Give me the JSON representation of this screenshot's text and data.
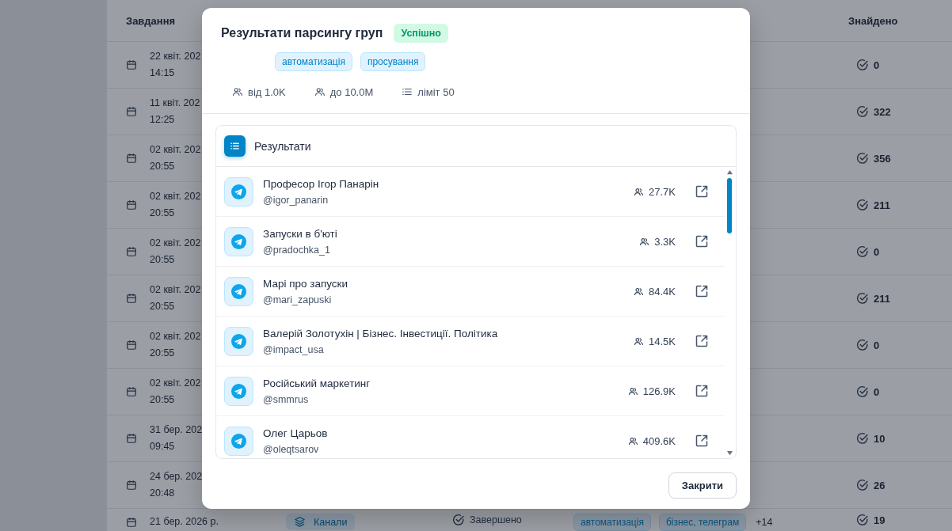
{
  "background_table": {
    "columns": [
      "Завдання",
      "Знайдено"
    ],
    "rows": [
      {
        "date": "22 квіт. 202",
        "time": "14:15",
        "found": "0"
      },
      {
        "date": "11 квіт. 202",
        "time": "12:25",
        "found": "322"
      },
      {
        "date": "02 квіт. 202",
        "time": "20:55",
        "found": "356"
      },
      {
        "date": "02 квіт. 202",
        "time": "20:55",
        "found": "211"
      },
      {
        "date": "02 квіт. 202",
        "time": "20:55",
        "found": "0"
      },
      {
        "date": "02 квіт. 202",
        "time": "20:55",
        "found": "211"
      },
      {
        "date": "02 квіт. 202",
        "time": "20:55",
        "found": "0"
      },
      {
        "date": "02 квіт. 202",
        "time": "20:55",
        "found": "0"
      },
      {
        "date": "31 бер. 202",
        "time": "09:45",
        "found": "10"
      },
      {
        "date": "24 бер. 202",
        "time": "20:48",
        "found": "26"
      },
      {
        "date": "21 бер. 2026 р.",
        "type": "Канали",
        "status": "Завершено",
        "tags": [
          "автоматизація",
          "бізнес, телеграм"
        ],
        "more": "+14",
        "found": "19"
      }
    ]
  },
  "modal": {
    "title": "Результати парсингу груп",
    "status": "Успішно",
    "tags": [
      "автоматизація",
      "просування"
    ],
    "filters": [
      {
        "kind": "min",
        "text": "від 1.0K"
      },
      {
        "kind": "max",
        "text": "до 10.0M"
      },
      {
        "kind": "limit",
        "text": "ліміт 50"
      }
    ],
    "results": {
      "title": "Результати",
      "items": [
        {
          "name": "Професор Ігор Панарін",
          "handle": "@igor_panarin",
          "members": "27.7K"
        },
        {
          "name": "Запуски в б'юті",
          "handle": "@pradochka_1",
          "members": "3.3K"
        },
        {
          "name": "Марі про запуски",
          "handle": "@mari_zapuski",
          "members": "84.4K"
        },
        {
          "name": "Валерій Золотухін | Бізнес. Інвестиції. Політика",
          "handle": "@impact_usa",
          "members": "14.5K"
        },
        {
          "name": "Російський маркетинг",
          "handle": "@smmrus",
          "members": "126.9K"
        },
        {
          "name": "Олег Царьов",
          "handle": "@oleqtsarov",
          "members": "409.6K"
        }
      ]
    },
    "close_button": "Закрити"
  }
}
